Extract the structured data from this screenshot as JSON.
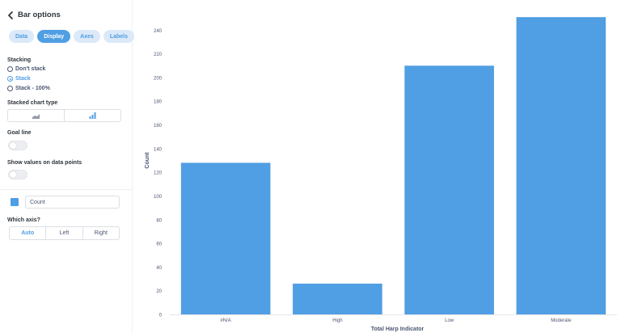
{
  "sidebar": {
    "title": "Bar options",
    "tabs": [
      {
        "label": "Data",
        "active": false
      },
      {
        "label": "Display",
        "active": true
      },
      {
        "label": "Axes",
        "active": false
      },
      {
        "label": "Labels",
        "active": false
      }
    ],
    "stacking": {
      "label": "Stacking",
      "options": [
        {
          "label": "Don't stack",
          "checked": false
        },
        {
          "label": "Stack",
          "checked": true
        },
        {
          "label": "Stack - 100%",
          "checked": false
        }
      ]
    },
    "stacked_chart_type": {
      "label": "Stacked chart type",
      "options": [
        "area-chart-icon",
        "bar-chart-icon"
      ],
      "selected": "bar-chart-icon"
    },
    "goal_line": {
      "label": "Goal line",
      "on": false
    },
    "show_values": {
      "label": "Show values on data points",
      "on": false
    },
    "series": {
      "name": "Count",
      "color": "#509ee3"
    },
    "which_axis": {
      "label": "Which axis?",
      "options": [
        "Auto",
        "Left",
        "Right"
      ],
      "selected": "Auto"
    }
  },
  "colors": {
    "accent": "#509ee3",
    "text": "#4c5773"
  },
  "chart_data": {
    "type": "bar",
    "categories": [
      "#N/A",
      "High",
      "Low",
      "Moderate"
    ],
    "series": [
      {
        "name": "Count",
        "values": [
          128,
          26,
          210,
          251
        ]
      }
    ],
    "xlabel": "Total Harp Indicator",
    "ylabel": "Count",
    "ylim": [
      0,
      260
    ],
    "yticks": [
      0,
      20,
      40,
      60,
      80,
      100,
      120,
      140,
      160,
      180,
      200,
      220,
      240
    ],
    "grid": false,
    "legend": "none"
  }
}
